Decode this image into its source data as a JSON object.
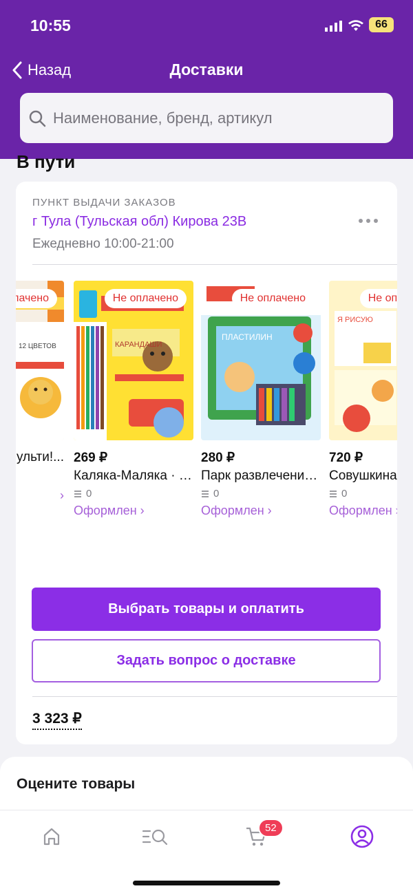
{
  "status_bar": {
    "time": "10:55",
    "battery": "66"
  },
  "nav": {
    "back_label": "Назад",
    "title": "Доставки"
  },
  "search": {
    "placeholder": "Наименование, бренд, артикул"
  },
  "section_title": "В пути",
  "pickup": {
    "label": "ПУНКТ ВЫДАЧИ ЗАКАЗОВ",
    "address": "г Тула (Тульская обл) Кирова 23В",
    "hours": "Ежедневно 10:00-21:00"
  },
  "products": [
    {
      "badge": "Не оплачено",
      "price": "",
      "name": "Мульти!...",
      "count": "",
      "status": "›",
      "image_label": "12 ЦВЕТОВ"
    },
    {
      "badge": "Не оплачено",
      "price": "269 ₽",
      "name": "Каляка-Маляка · Карандаши",
      "count": "0",
      "status": "Оформлен ›",
      "image_label": "КАРАНДАШИ"
    },
    {
      "badge": "Не оплачено",
      "price": "280 ₽",
      "name": "Парк развлечений пластилин",
      "count": "0",
      "status": "Оформлен ›",
      "image_label": "ПЛАСТИЛИН"
    },
    {
      "badge": "Не оплачено",
      "price": "720 ₽",
      "name": "Совушкина",
      "count": "0",
      "status": "Оформлен ›",
      "image_label": "Я РИСУЮ"
    }
  ],
  "actions": {
    "pay_button": "Выбрать товары и оплатить",
    "ask_button": "Задать вопрос о доставке"
  },
  "total": "3 323 ₽",
  "rate": {
    "title": "Оцените товары"
  },
  "tabbar": {
    "cart_count": "52"
  },
  "colors": {
    "header": "#6a24a8",
    "accent": "#8b2ee6",
    "badge_text": "#e0302f"
  }
}
